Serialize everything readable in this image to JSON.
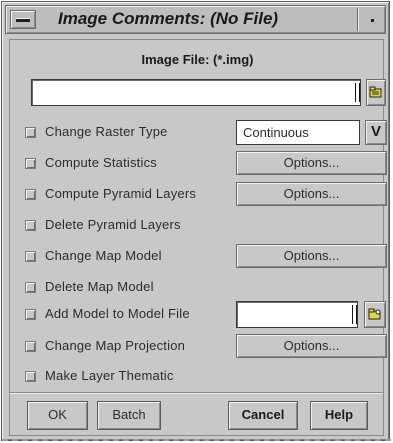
{
  "window": {
    "title": "Image Comments: (No File)"
  },
  "file": {
    "label": "Image File: (*.img)",
    "value": ""
  },
  "options": [
    {
      "label": "Change Raster Type",
      "control": "select",
      "control_label": "Continuous"
    },
    {
      "label": "Compute Statistics",
      "control": "button",
      "control_label": "Options..."
    },
    {
      "label": "Compute Pyramid Layers",
      "control": "button",
      "control_label": "Options..."
    },
    {
      "label": "Delete Pyramid Layers",
      "control": "none"
    },
    {
      "label": "Change Map Model",
      "control": "button",
      "control_label": "Options..."
    },
    {
      "label": "Delete Map Model",
      "control": "none"
    },
    {
      "label": "Add Model to Model File",
      "control": "input"
    },
    {
      "label": "Change Map Projection",
      "control": "button",
      "control_label": "Options..."
    },
    {
      "label": "Make Layer Thematic",
      "control": "none"
    }
  ],
  "select_arrow": "V",
  "buttons": {
    "ok": "OK",
    "batch": "Batch",
    "cancel": "Cancel",
    "help": "Help"
  },
  "icons": {
    "window_menu": "window-menu-icon",
    "minimize": "minimize-icon",
    "open_folder": "folder-icon",
    "browse": "browse-icon"
  }
}
